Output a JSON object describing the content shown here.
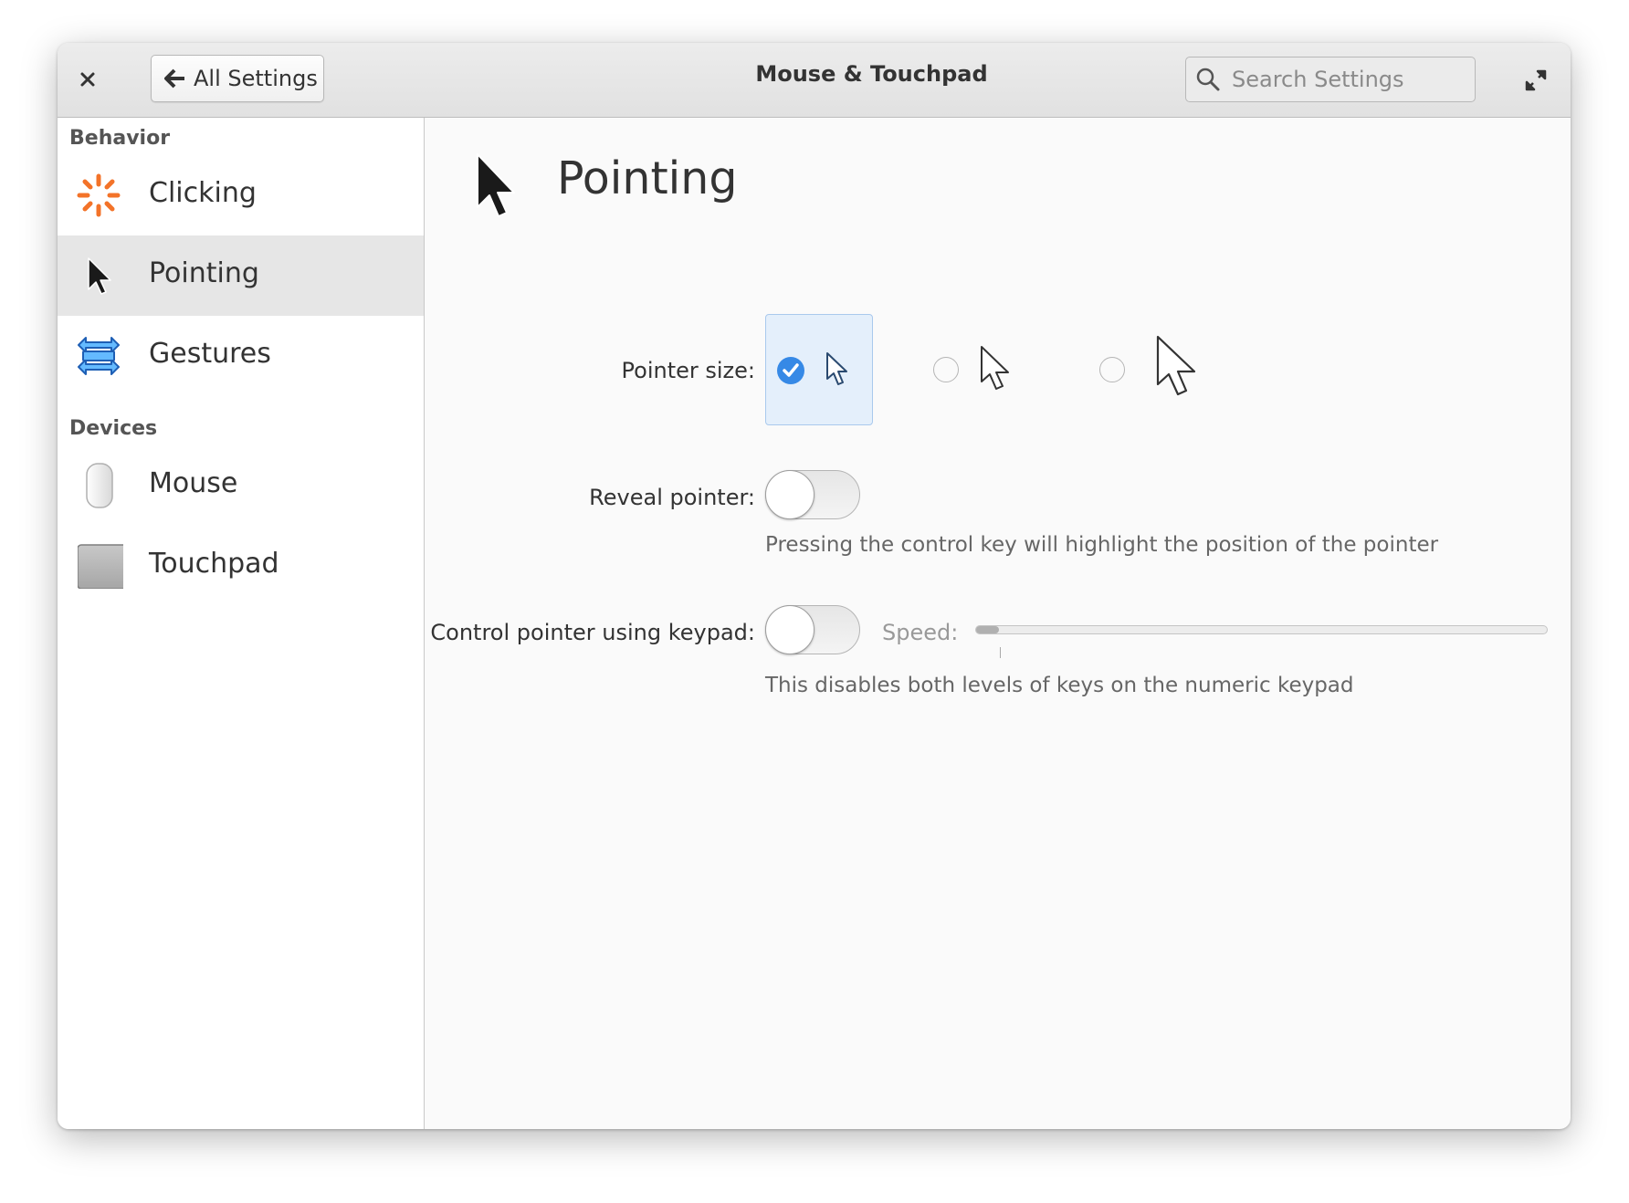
{
  "window": {
    "title": "Mouse & Touchpad",
    "back_label": "All Settings",
    "search_placeholder": "Search Settings"
  },
  "sidebar": {
    "sections": [
      {
        "header": "Behavior",
        "items": [
          {
            "label": "Clicking",
            "icon": "clicking-icon",
            "selected": false
          },
          {
            "label": "Pointing",
            "icon": "pointer-arrow-icon",
            "selected": true
          },
          {
            "label": "Gestures",
            "icon": "gestures-icon",
            "selected": false
          }
        ]
      },
      {
        "header": "Devices",
        "items": [
          {
            "label": "Mouse",
            "icon": "mouse-icon",
            "selected": false
          },
          {
            "label": "Touchpad",
            "icon": "touchpad-icon",
            "selected": false
          }
        ]
      }
    ]
  },
  "page": {
    "title": "Pointing",
    "icon": "pointer-arrow-icon",
    "pointer_size": {
      "label": "Pointer size:",
      "options": [
        "small",
        "medium",
        "large"
      ],
      "selected_index": 0
    },
    "reveal_pointer": {
      "label": "Reveal pointer:",
      "enabled": false,
      "description": "Pressing the control key will highlight the position of the pointer"
    },
    "keypad_control": {
      "label": "Control pointer using keypad:",
      "enabled": false,
      "speed_label": "Speed:",
      "speed_fraction": 0.04,
      "description": "This disables both levels of keys on the numeric keypad"
    }
  },
  "colors": {
    "accent": "#3689e6",
    "clicking_icon": "#f37329",
    "gestures_icon": "#3689e6"
  }
}
